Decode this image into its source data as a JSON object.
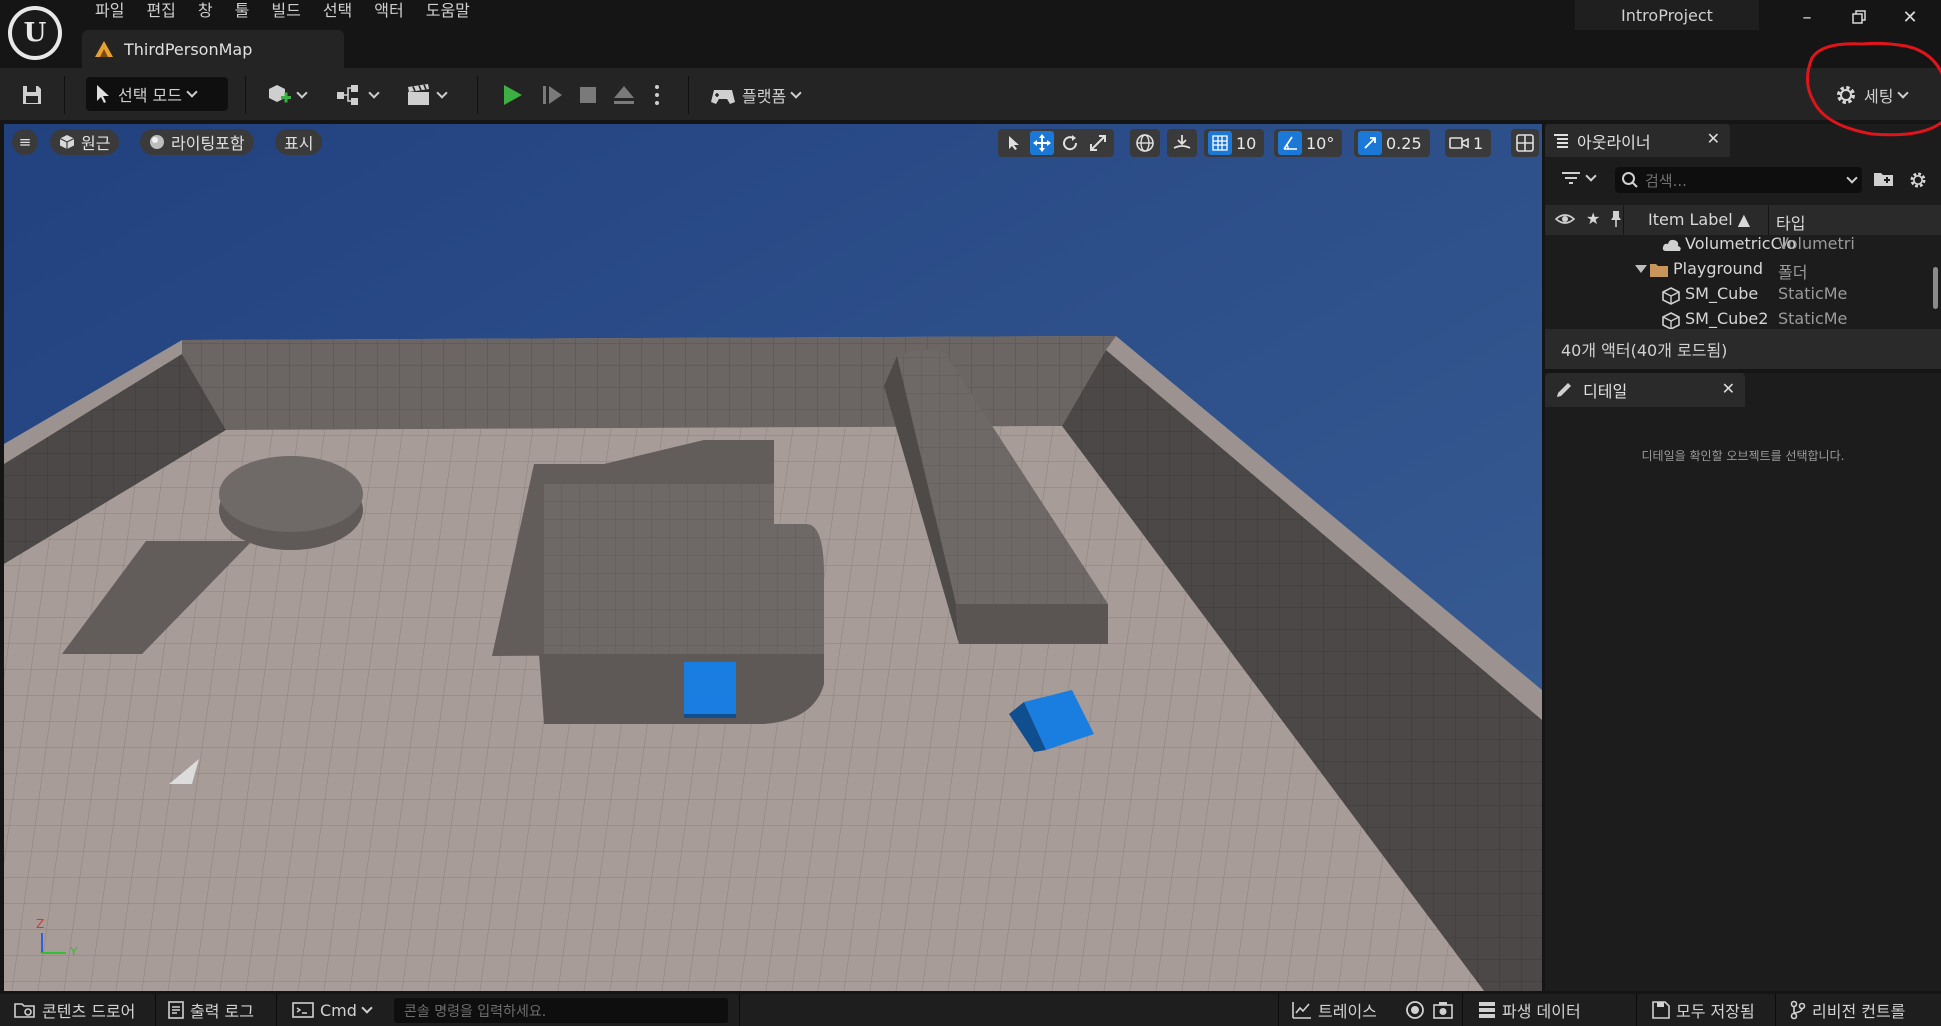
{
  "menu": [
    "파일",
    "편집",
    "창",
    "툴",
    "빌드",
    "선택",
    "액터",
    "도움말"
  ],
  "map_tab": {
    "label": "ThirdPersonMap"
  },
  "project_name": "IntroProject",
  "toolbar": {
    "mode_label": "선택 모드",
    "platform_label": "플랫폼",
    "settings_label": "세팅"
  },
  "viewport": {
    "perspective_label": "원근",
    "lit_label": "라이팅포함",
    "show_label": "표시",
    "grid_snap": "10",
    "rotation_snap": "10°",
    "scale_snap": "0.25",
    "camera_speed": "1",
    "axis_z": "Z",
    "axis_y": "Y"
  },
  "outliner": {
    "tab_label": "아웃라이너",
    "search_placeholder": "검색...",
    "col_label": "Item Label ▲",
    "col_type": "타입",
    "rows": [
      {
        "label": "VolumetricClo",
        "type": "Volumetri"
      },
      {
        "label": "Playground",
        "type": "폴더"
      },
      {
        "label": "SM_Cube",
        "type": "StaticMe"
      },
      {
        "label": "SM_Cube2",
        "type": "StaticMe"
      }
    ],
    "footer": "40개 액터(40개 로드됨)"
  },
  "details": {
    "tab_label": "디테일",
    "empty_text": "디테일을 확인할 오브젝트를 선택합니다."
  },
  "statusbar": {
    "content_drawer": "콘텐츠 드로어",
    "output_log": "출력 로그",
    "cmd": "Cmd",
    "console_placeholder": "콘솔 명령을 입력하세요.",
    "trace": "트레이스",
    "derived_data": "파생 데이터",
    "save_all": "모두 저장됨",
    "revision_control": "리비전 컨트롤"
  },
  "colors": {
    "accent_blue": "#1c78d6",
    "play_green": "#3cb043",
    "annotation_red": "#e0141b",
    "sky": "#2b4a86"
  }
}
